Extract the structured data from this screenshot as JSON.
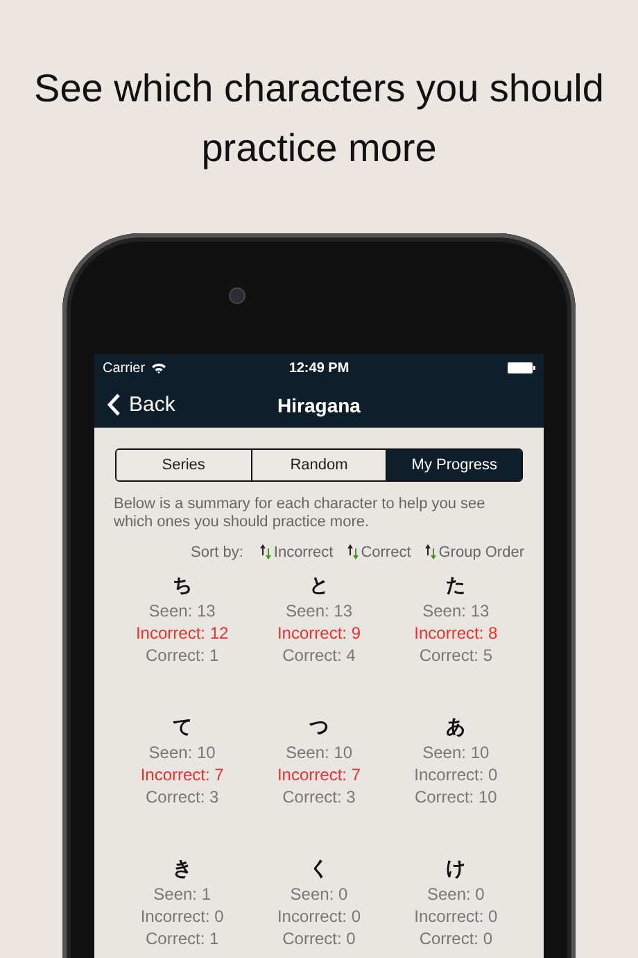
{
  "headline": "See which characters you should practice more",
  "status_bar": {
    "carrier": "Carrier",
    "time": "12:49 PM"
  },
  "nav": {
    "back": "Back",
    "title": "Hiragana"
  },
  "segments": [
    {
      "label": "Series",
      "selected": false
    },
    {
      "label": "Random",
      "selected": false
    },
    {
      "label": "My Progress",
      "selected": true
    }
  ],
  "description": "Below is a summary for each character to help you see which ones you should practice more.",
  "sort": {
    "label": "Sort by:",
    "options": [
      "Incorrect",
      "Correct",
      "Group Order"
    ]
  },
  "characters": [
    {
      "char": "ち",
      "seen": "Seen: 13",
      "incorrect": "Incorrect: 12",
      "correct": "Correct: 1",
      "highlight": true
    },
    {
      "char": "と",
      "seen": "Seen: 13",
      "incorrect": "Incorrect: 9",
      "correct": "Correct: 4",
      "highlight": true
    },
    {
      "char": "た",
      "seen": "Seen: 13",
      "incorrect": "Incorrect: 8",
      "correct": "Correct: 5",
      "highlight": true
    },
    {
      "char": "て",
      "seen": "Seen: 10",
      "incorrect": "Incorrect: 7",
      "correct": "Correct: 3",
      "highlight": true
    },
    {
      "char": "つ",
      "seen": "Seen: 10",
      "incorrect": "Incorrect: 7",
      "correct": "Correct: 3",
      "highlight": true
    },
    {
      "char": "あ",
      "seen": "Seen: 10",
      "incorrect": "Incorrect: 0",
      "correct": "Correct: 10",
      "highlight": false
    },
    {
      "char": "き",
      "seen": "Seen: 1",
      "incorrect": "Incorrect: 0",
      "correct": "Correct: 1",
      "highlight": false
    },
    {
      "char": "く",
      "seen": "Seen: 0",
      "incorrect": "Incorrect: 0",
      "correct": "Correct: 0",
      "highlight": false
    },
    {
      "char": "け",
      "seen": "Seen: 0",
      "incorrect": "Incorrect: 0",
      "correct": "Correct: 0",
      "highlight": false
    }
  ]
}
